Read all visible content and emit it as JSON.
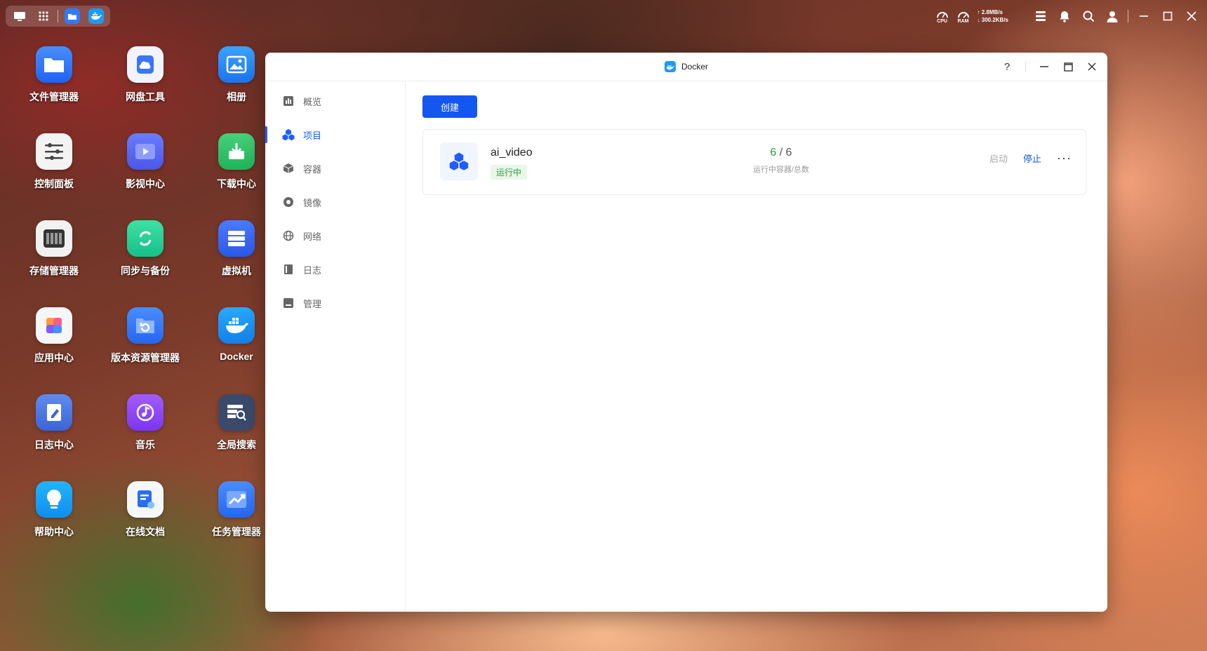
{
  "topbar": {
    "cpu_label": "CPU",
    "ram_label": "RAM",
    "upload": "↑ 2.8MB/s",
    "download": "↓ 300.2KB/s"
  },
  "desktop": {
    "icons": [
      {
        "label": "文件管理器",
        "icon": "folder-icon"
      },
      {
        "label": "网盘工具",
        "icon": "cloud-drive-icon"
      },
      {
        "label": "相册",
        "icon": "photo-icon"
      },
      {
        "label": "控制面板",
        "icon": "sliders-icon"
      },
      {
        "label": "影视中心",
        "icon": "video-icon"
      },
      {
        "label": "下载中心",
        "icon": "download-icon"
      },
      {
        "label": "存储管理器",
        "icon": "storage-icon"
      },
      {
        "label": "同步与备份",
        "icon": "sync-icon"
      },
      {
        "label": "虚拟机",
        "icon": "server-icon"
      },
      {
        "label": "应用中心",
        "icon": "app-center-icon"
      },
      {
        "label": "版本资源管理器",
        "icon": "version-folder-icon"
      },
      {
        "label": "Docker",
        "icon": "docker-icon"
      },
      {
        "label": "日志中心",
        "icon": "log-icon"
      },
      {
        "label": "音乐",
        "icon": "music-icon"
      },
      {
        "label": "全局搜索",
        "icon": "global-search-icon"
      },
      {
        "label": "帮助中心",
        "icon": "lightbulb-icon"
      },
      {
        "label": "在线文档",
        "icon": "document-icon"
      },
      {
        "label": "任务管理器",
        "icon": "task-chart-icon"
      }
    ]
  },
  "window": {
    "title": "Docker",
    "help": "?",
    "sidebar": [
      {
        "label": "概览",
        "icon": "overview-icon"
      },
      {
        "label": "项目",
        "icon": "project-icon",
        "active": true
      },
      {
        "label": "容器",
        "icon": "container-icon"
      },
      {
        "label": "镜像",
        "icon": "image-icon"
      },
      {
        "label": "网络",
        "icon": "network-icon"
      },
      {
        "label": "日志",
        "icon": "log-book-icon"
      },
      {
        "label": "管理",
        "icon": "manage-icon"
      }
    ],
    "create_label": "创建",
    "project": {
      "name": "ai_video",
      "status": "运行中",
      "running": "6",
      "separator": " / ",
      "total": "6",
      "stat_caption": "运行中容器/总数",
      "start_label": "启动",
      "stop_label": "停止",
      "more_label": "···"
    }
  },
  "colors": {
    "accent": "#1456f0",
    "success": "#22a33b"
  }
}
